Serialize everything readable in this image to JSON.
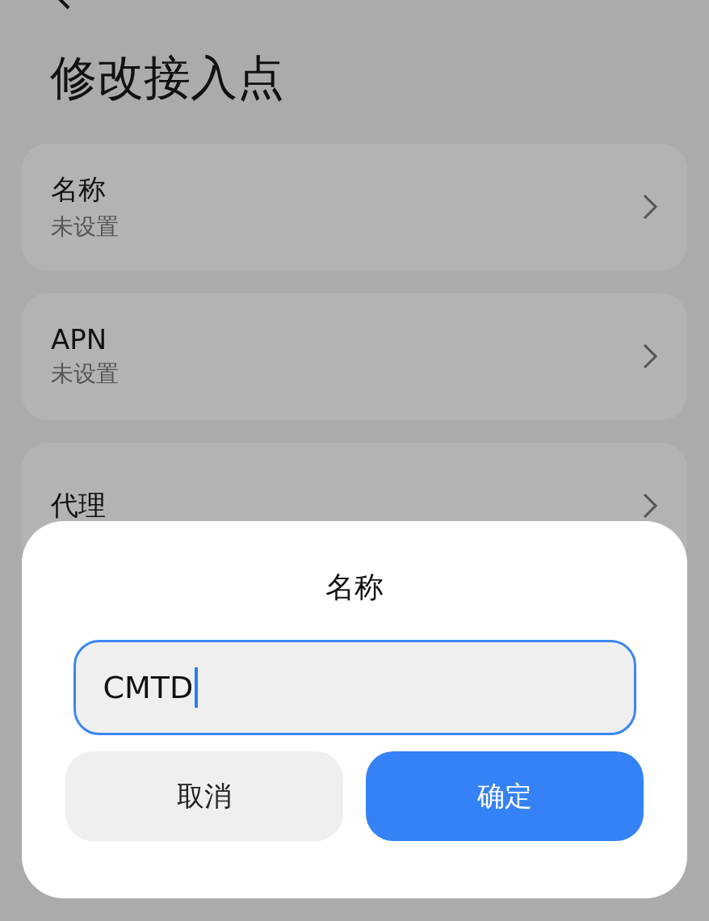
{
  "title": "修改接入点",
  "items": [
    {
      "label": "名称",
      "value": "未设置"
    },
    {
      "label": "APN",
      "value": "未设置"
    },
    {
      "label": "代理"
    }
  ],
  "dialog": {
    "title": "名称",
    "input": {
      "value": "CMTD",
      "focused": true
    },
    "buttons": [
      {
        "label": "取消",
        "kind": "secondary"
      },
      {
        "label": "确定",
        "kind": "primary"
      }
    ]
  }
}
